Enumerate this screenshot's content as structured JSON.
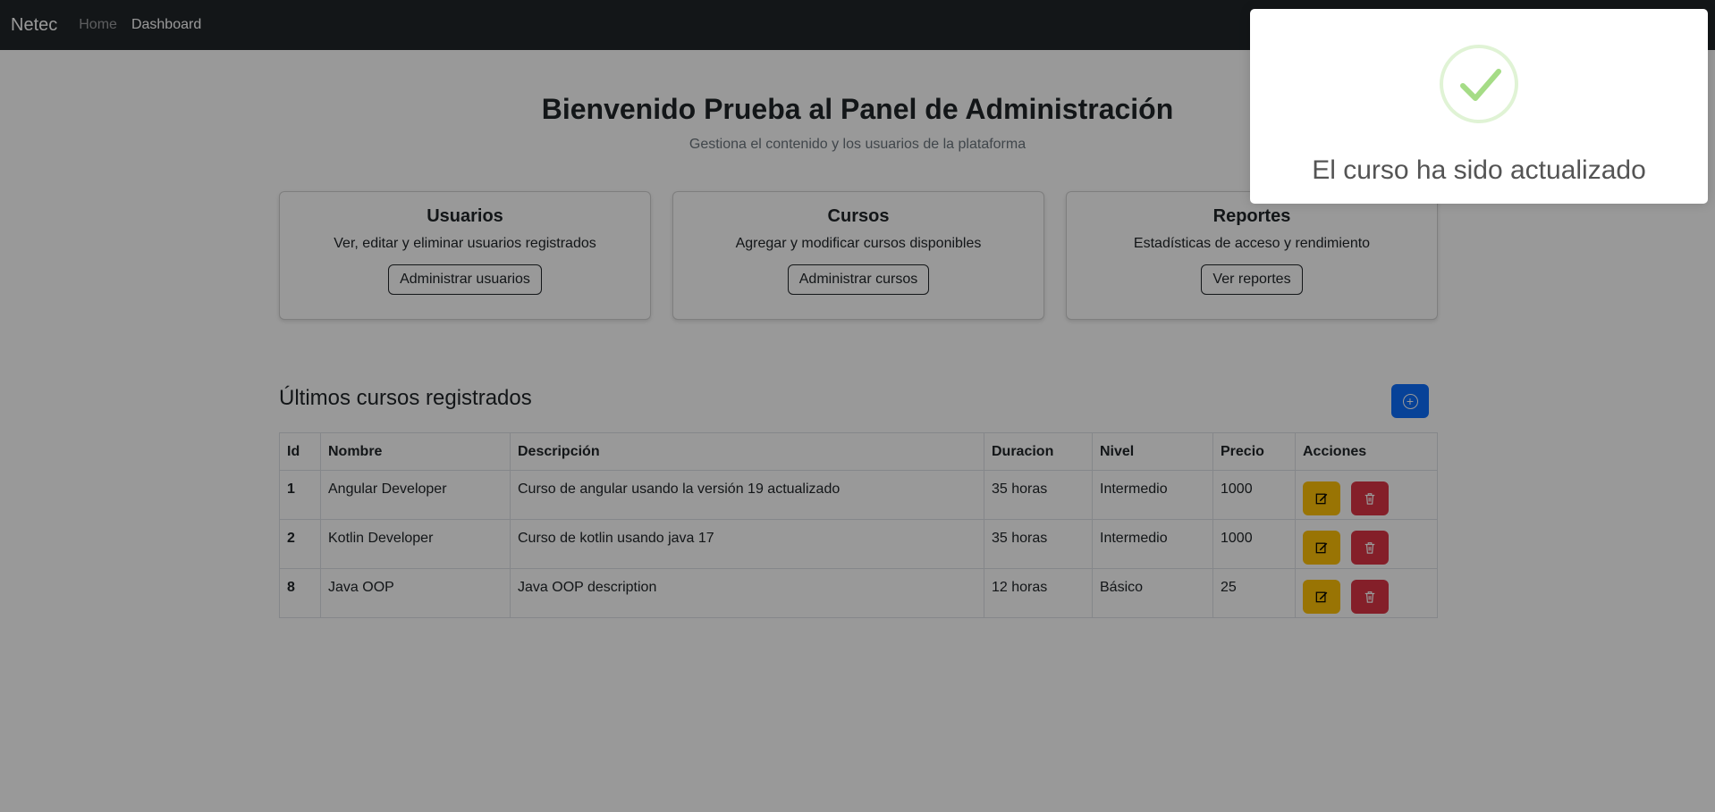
{
  "navbar": {
    "brand": "Netec",
    "links": [
      "Home",
      "Dashboard"
    ]
  },
  "header": {
    "title": "Bienvenido Prueba al Panel de Administración",
    "subtitle": "Gestiona el contenido y los usuarios de la plataforma"
  },
  "cards": [
    {
      "title": "Usuarios",
      "text": "Ver, editar y eliminar usuarios registrados",
      "button": "Administrar usuarios"
    },
    {
      "title": "Cursos",
      "text": "Agregar y modificar cursos disponibles",
      "button": "Administrar cursos"
    },
    {
      "title": "Reportes",
      "text": "Estadísticas de acceso y rendimiento",
      "button": "Ver reportes"
    }
  ],
  "section": {
    "title": "Últimos cursos registrados",
    "add_icon": "plus-circle-icon"
  },
  "table": {
    "headers": [
      "Id",
      "Nombre",
      "Descripción",
      "Duracion",
      "Nivel",
      "Precio",
      "Acciones"
    ],
    "rows": [
      {
        "id": "1",
        "nombre": "Angular Developer",
        "descripcion": "Curso de angular usando la versión 19 actualizado",
        "duracion": "35 horas",
        "nivel": "Intermedio",
        "precio": "1000"
      },
      {
        "id": "2",
        "nombre": "Kotlin Developer",
        "descripcion": "Curso de kotlin usando java 17",
        "duracion": "35 horas",
        "nivel": "Intermedio",
        "precio": "1000"
      },
      {
        "id": "8",
        "nombre": "Java OOP",
        "descripcion": "Java OOP description",
        "duracion": "12 horas",
        "nivel": "Básico",
        "precio": "25"
      }
    ],
    "action_icons": [
      "edit-icon",
      "trash-icon"
    ]
  },
  "toast": {
    "title": "El curso ha sido actualizado",
    "icon": "success-check-icon"
  },
  "colors": {
    "navbar": "#212529",
    "primary": "#0d6efd",
    "warning": "#ffc107",
    "danger": "#dc3545",
    "success_check": "#a5dc86"
  }
}
